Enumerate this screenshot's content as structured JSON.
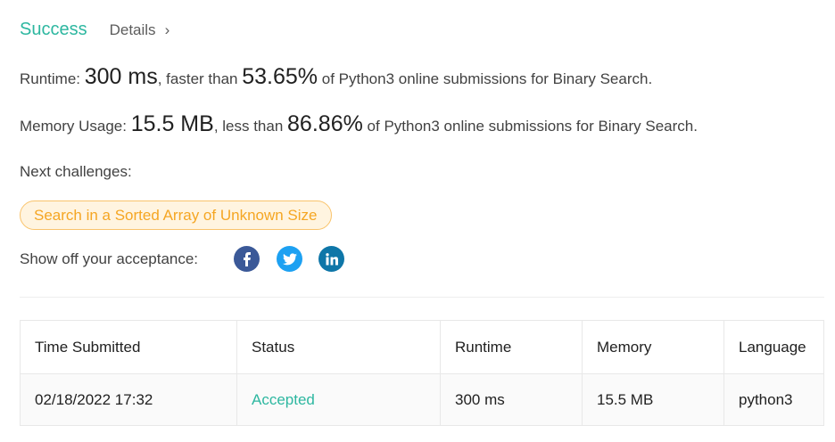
{
  "header": {
    "status": "Success",
    "details_label": "Details",
    "chevron": "›"
  },
  "runtime": {
    "label": "Runtime: ",
    "value": "300 ms",
    "mid": ", faster than ",
    "percent": "53.65%",
    "suffix": " of Python3 online submissions for Binary Search."
  },
  "memory": {
    "label": "Memory Usage: ",
    "value": "15.5 MB",
    "mid": ", less than ",
    "percent": "86.86%",
    "suffix": " of Python3 online submissions for Binary Search."
  },
  "next_challenges": {
    "label": "Next challenges:",
    "items": [
      "Search in a Sorted Array of Unknown Size"
    ]
  },
  "share": {
    "label": "Show off your acceptance:",
    "icons": [
      "facebook-icon",
      "twitter-icon",
      "linkedin-icon"
    ],
    "colors": {
      "facebook": "#3b5998",
      "twitter": "#1da1f2",
      "linkedin": "#0e76a8"
    }
  },
  "table": {
    "headers": [
      "Time Submitted",
      "Status",
      "Runtime",
      "Memory",
      "Language"
    ],
    "rows": [
      {
        "time": "02/18/2022 17:32",
        "status": "Accepted",
        "runtime": "300 ms",
        "memory": "15.5 MB",
        "language": "python3"
      }
    ]
  },
  "colors": {
    "accent": "#2db7a0",
    "chip_text": "#f5a623",
    "chip_bg": "#fff4e0",
    "chip_border": "#f9c36b"
  }
}
